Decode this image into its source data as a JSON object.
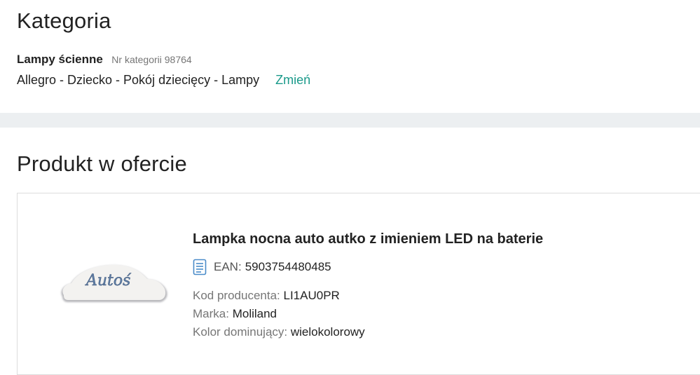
{
  "category": {
    "heading": "Kategoria",
    "name": "Lampy ścienne",
    "number_text": "Nr kategorii 98764",
    "path": "Allegro - Dziecko - Pokój dziecięcy - Lampy",
    "change_label": "Zmień"
  },
  "product_section": {
    "heading": "Produkt w ofercie",
    "product": {
      "name": "Lampka nocna auto autko z imieniem LED na baterie",
      "image_text": "Autoś",
      "ean_label": "EAN:",
      "ean_value": "5903754480485",
      "attributes": [
        {
          "key": "Kod producenta:",
          "value": "LI1AU0PR"
        },
        {
          "key": "Marka:",
          "value": "Moliland"
        },
        {
          "key": "Kolor dominujący:",
          "value": "wielokolorowy"
        }
      ]
    }
  },
  "colors": {
    "link": "#1a9a8a",
    "divider": "#eceff1",
    "ean_icon": "#4a8cc9"
  },
  "icons": {
    "ean": "document-list-icon"
  }
}
